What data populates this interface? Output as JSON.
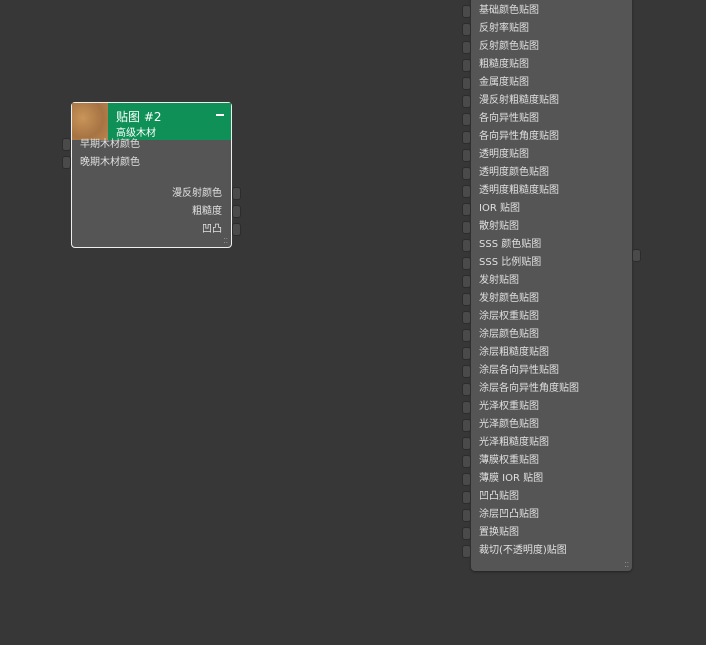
{
  "map_node": {
    "title": "贴图 #2",
    "subtitle": "高级木材",
    "inputs": [
      "早期木材颜色",
      "晚期木材颜色"
    ],
    "outputs": [
      "漫反射颜色",
      "粗糙度",
      "凹凸"
    ],
    "header_color": "#0f9057"
  },
  "material_node": {
    "inputs": [
      "基础颜色贴图",
      "反射率贴图",
      "反射颜色贴图",
      "粗糙度贴图",
      "金属度贴图",
      "漫反射粗糙度贴图",
      "各向异性贴图",
      "各向异性角度贴图",
      "透明度贴图",
      "透明度颜色贴图",
      "透明度粗糙度贴图",
      "IOR 贴图",
      "散射贴图",
      "SSS 颜色贴图",
      "SSS 比例贴图",
      "发射贴图",
      "发射颜色贴图",
      "涂层权重贴图",
      "涂层颜色贴图",
      "涂层粗糙度贴图",
      "涂层各向异性贴图",
      "涂层各向异性角度贴图",
      "光泽权重贴图",
      "光泽颜色贴图",
      "光泽粗糙度贴图",
      "薄膜权重贴图",
      "薄膜 IOR 贴图",
      "凹凸贴图",
      "涂层凹凸贴图",
      "置换贴图",
      "裁切(不透明度)贴图"
    ]
  }
}
